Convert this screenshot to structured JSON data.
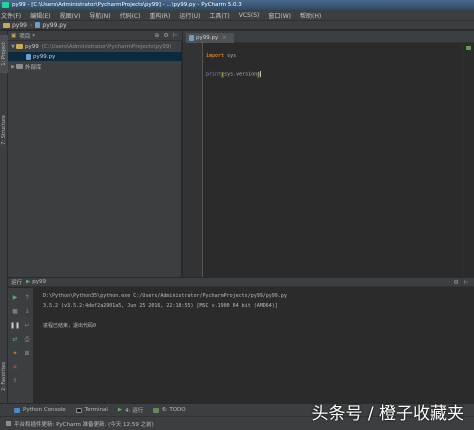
{
  "window": {
    "title": "py99 - [C:\\Users\\Administrator\\PycharmProjects\\py99] - ...\\py99.py - PyCharm 5.0.3"
  },
  "menu": [
    "文件(F)",
    "编辑(E)",
    "视图(V)",
    "导航(N)",
    "代码(C)",
    "重构(R)",
    "运行(U)",
    "工具(T)",
    "VCS(S)",
    "窗口(W)",
    "帮助(H)"
  ],
  "navbar": {
    "crumbs": [
      "py99",
      "py99.py"
    ]
  },
  "left_strip": {
    "project_tab": "1: Project",
    "structure_tab": "7: Structure",
    "favorites_tab": "2: Favorites"
  },
  "project_panel": {
    "header": "项目",
    "root_name": "py99",
    "root_path": "(C:\\Users\\Administrator\\PycharmProjects\\py99)",
    "file_name": "py99.py",
    "external_libs": "外部库"
  },
  "editor": {
    "tab_label": "py99.py",
    "code": {
      "import_kw": "import",
      "import_mod": "sys",
      "print_fn": "print",
      "print_arg": "sys.version"
    }
  },
  "run_panel": {
    "header": "运行",
    "config_name": "py99",
    "lines": [
      "D:\\Python\\Python35\\python.exe C:/Users/Administrator/PycharmProjects/py99/py99.py",
      "3.5.2 (v3.5.2:4def2a2901a5, Jun 25 2016, 22:18:55) [MSC v.1900 64 bit (AMD64)]",
      "",
      "进程已结束，退出代码0"
    ]
  },
  "bottom_tabs": {
    "python_console": "Python Console",
    "terminal": "Terminal",
    "run": "4: 运行",
    "todo": "6: TODO"
  },
  "statusbar": {
    "text": "平台和插件更新: PyCharm 准备更新. (今天 12:59 之前)"
  },
  "watermark": {
    "text": "头条号 / 橙子收藏夹"
  },
  "colors": {
    "background": "#2b2b2b",
    "panel": "#3c3f41",
    "keyword": "#cc7832",
    "selection": "#0d293e",
    "run_green": "#59a869"
  }
}
